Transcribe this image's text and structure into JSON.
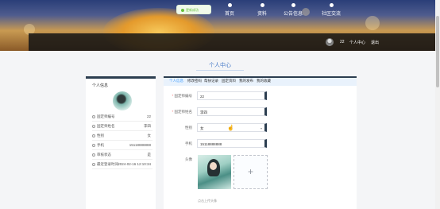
{
  "toast": {
    "text": "更新成功"
  },
  "nav": {
    "items": [
      {
        "label": "首页"
      },
      {
        "label": "资料"
      },
      {
        "label": "公告信息"
      },
      {
        "label": "社区交流"
      }
    ],
    "user_name": "22",
    "user_center": "个人中心",
    "logout": "退出"
  },
  "page": {
    "title": "个人中心"
  },
  "left_card": {
    "heading": "个人信息",
    "rows": [
      {
        "label": "固定师编号",
        "value": "22"
      },
      {
        "label": "固定师姓名",
        "value": "李四"
      },
      {
        "label": "性别",
        "value": "女"
      },
      {
        "label": "手机",
        "value": "15118888888"
      },
      {
        "label": "审核状态",
        "value": "是"
      },
      {
        "label": "最近登录时间",
        "value": "2024-02-16 12:10:34"
      }
    ]
  },
  "tabs": [
    "个人信息",
    "修改密码",
    "帮扶记录",
    "固定资料",
    "我的发布",
    "我的收藏"
  ],
  "form": {
    "fields": [
      {
        "label": "固定师编号",
        "required": "*",
        "value": "22"
      },
      {
        "label": "固定师姓名",
        "required": "*",
        "value": "李四"
      },
      {
        "label": "性别",
        "required": "",
        "value": "女"
      },
      {
        "label": "手机",
        "required": "",
        "value": "15118888888"
      }
    ],
    "avatar_label": "头像",
    "upload_plus": "+",
    "upload_tip": "点击上传头像"
  }
}
